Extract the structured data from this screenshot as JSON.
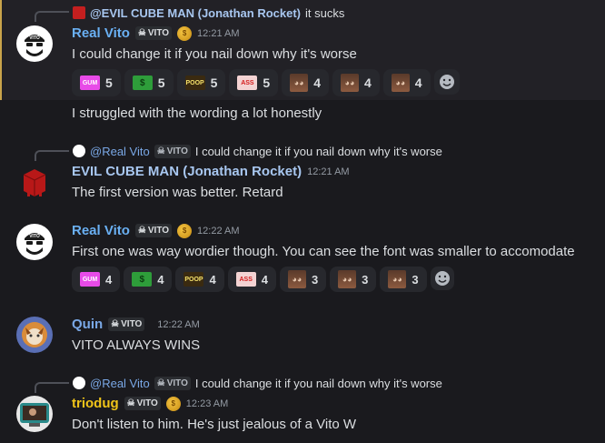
{
  "messages": [
    {
      "reply": {
        "author": "@EVIL CUBE MAN (Jonathan Rocket)",
        "text": "it sucks"
      },
      "author": "Real Vito",
      "tag": "VITO",
      "time": "12:21 AM",
      "lines": [
        "I could change it if you nail down why it's worse",
        "I struggled with the wording a lot honestly"
      ],
      "reactions": [
        {
          "emoji": "gum",
          "label": "GUM",
          "count": "5"
        },
        {
          "emoji": "money",
          "label": "$",
          "count": "5"
        },
        {
          "emoji": "poop",
          "label": "POOP",
          "count": "5"
        },
        {
          "emoji": "ass",
          "label": "ASS",
          "count": "5"
        },
        {
          "emoji": "face",
          "label": "",
          "count": "4"
        },
        {
          "emoji": "face",
          "label": "",
          "count": "4"
        },
        {
          "emoji": "face",
          "label": "",
          "count": "4"
        }
      ]
    },
    {
      "reply": {
        "author": "@Real Vito",
        "tag": "VITO",
        "text": "I could change it if you nail down why it's worse"
      },
      "author": "EVIL CUBE MAN (Jonathan Rocket)",
      "time": "12:21 AM",
      "lines": [
        "The first version was better. Retard"
      ]
    },
    {
      "author": "Real Vito",
      "tag": "VITO",
      "time": "12:22 AM",
      "lines": [
        "First one was way wordier though. You can see the font was smaller to accomodate"
      ],
      "reactions": [
        {
          "emoji": "gum",
          "label": "GUM",
          "count": "4"
        },
        {
          "emoji": "money",
          "label": "$",
          "count": "4"
        },
        {
          "emoji": "poop",
          "label": "POOP",
          "count": "4"
        },
        {
          "emoji": "ass",
          "label": "ASS",
          "count": "4"
        },
        {
          "emoji": "face",
          "label": "",
          "count": "3"
        },
        {
          "emoji": "face",
          "label": "",
          "count": "3"
        },
        {
          "emoji": "face",
          "label": "",
          "count": "3"
        }
      ]
    },
    {
      "author": "Quin",
      "tag": "VITO",
      "time": "12:22 AM",
      "lines": [
        "VITO ALWAYS WINS"
      ]
    },
    {
      "reply": {
        "author": "@Real Vito",
        "tag": "VITO",
        "text": "I could change it if you nail down why it's worse"
      },
      "author": "triodug",
      "tag": "VITO",
      "time": "12:23 AM",
      "lines": [
        "Don't listen to him. He's just jealous of a Vito W"
      ]
    }
  ],
  "colors": {
    "real_vito": "#6ab0f3",
    "evil_cube": "#a8c7f0",
    "quin": "#7aa8e6",
    "triodug": "#f0c419",
    "reply_name": "#7aa8e6"
  }
}
